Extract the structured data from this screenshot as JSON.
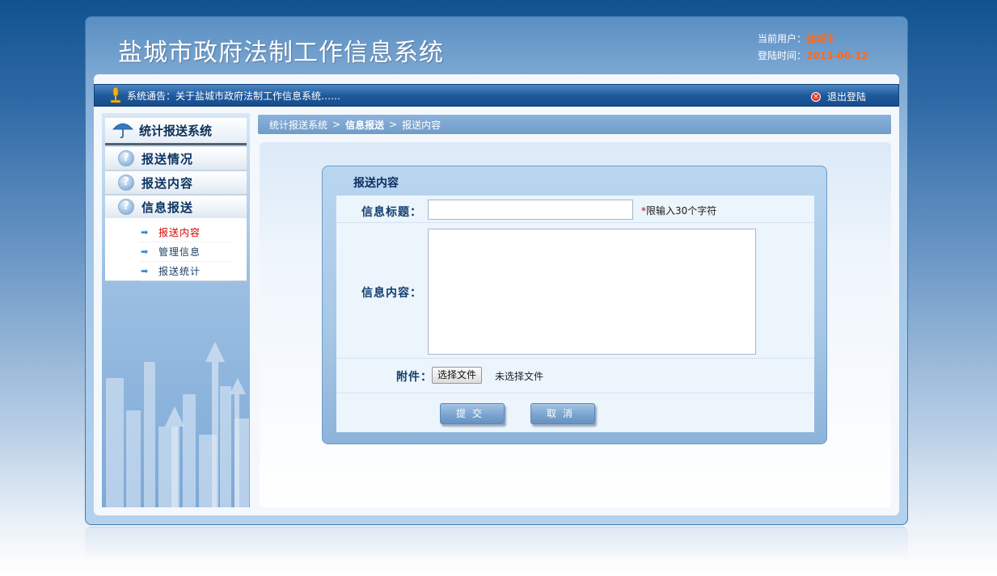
{
  "header": {
    "system_title": "盐城市政府法制工作信息系统",
    "current_user_label": "当前用户：",
    "current_user_value": "盐城市",
    "login_time_label": "登陆时间：",
    "login_time_value": "2013-06-12"
  },
  "noticebar": {
    "notice_text": "系统通告：关于盐城市政府法制工作信息系统……",
    "logout_label": "退出登陆"
  },
  "sidebar": {
    "header_title": "统计报送系统",
    "items": [
      {
        "label": "报送情况",
        "icon": "question-icon"
      },
      {
        "label": "报送内容",
        "icon": "question-icon"
      },
      {
        "label": "信息报送",
        "icon": "question-icon"
      }
    ],
    "subitems": [
      {
        "label": "报送内容",
        "active": true
      },
      {
        "label": "管理信息",
        "active": false
      },
      {
        "label": "报送统计",
        "active": false
      }
    ]
  },
  "breadcrumb": {
    "items": [
      "统计报送系统",
      "信息报送",
      "报送内容"
    ],
    "separator": ">"
  },
  "form": {
    "panel_title": "报送内容",
    "title_label": "信息标题：",
    "title_value": "",
    "title_hint_star": "*",
    "title_hint": "限输入30个字符",
    "content_label": "信息内容：",
    "content_value": "",
    "attachment_label": "附件：",
    "choose_file_label": "选择文件",
    "file_status": "未选择文件",
    "submit_label": "提交",
    "cancel_label": "取消"
  },
  "colors": {
    "accent": "#1f5a9c",
    "user_value": "#ff6a1a",
    "active_subitem": "#d40000"
  }
}
